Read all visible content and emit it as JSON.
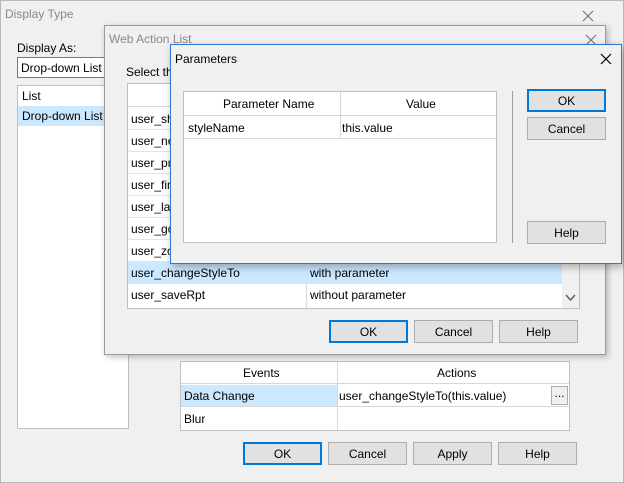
{
  "display_type": {
    "title": "Display Type",
    "display_as_label": "Display As:",
    "display_as_value": "Drop-down List",
    "list_items": [
      "List",
      "Drop-down List"
    ],
    "events_table": {
      "headers": [
        "Events",
        "Actions"
      ],
      "rows": [
        {
          "event": "Data Change",
          "action": "user_changeStyleTo(this.value)",
          "ellipsis": "..."
        },
        {
          "event": "Blur",
          "action": ""
        }
      ]
    },
    "buttons": {
      "ok": "OK",
      "cancel": "Cancel",
      "apply": "Apply",
      "help": "Help"
    }
  },
  "web_action_list": {
    "title": "Web Action List",
    "select_label": "Select the",
    "rows": [
      {
        "name": "user_sh",
        "desc": ""
      },
      {
        "name": "user_ne",
        "desc": ""
      },
      {
        "name": "user_pre",
        "desc": ""
      },
      {
        "name": "user_firs",
        "desc": ""
      },
      {
        "name": "user_las",
        "desc": ""
      },
      {
        "name": "user_go",
        "desc": ""
      },
      {
        "name": "user_zoo",
        "desc": ""
      },
      {
        "name": "user_changeStyleTo",
        "desc": "with parameter"
      },
      {
        "name": "user_saveRpt",
        "desc": "without parameter"
      }
    ],
    "buttons": {
      "ok": "OK",
      "cancel": "Cancel",
      "help": "Help"
    }
  },
  "parameters": {
    "title": "Parameters",
    "headers": [
      "Parameter Name",
      "Value"
    ],
    "rows": [
      {
        "name": "styleName",
        "value": "this.value"
      }
    ],
    "buttons": {
      "ok": "OK",
      "cancel": "Cancel",
      "help": "Help"
    }
  },
  "colors": {
    "selection": "#cce8ff",
    "accent": "#0078d7",
    "dialog_bg": "#f0f0f0"
  }
}
